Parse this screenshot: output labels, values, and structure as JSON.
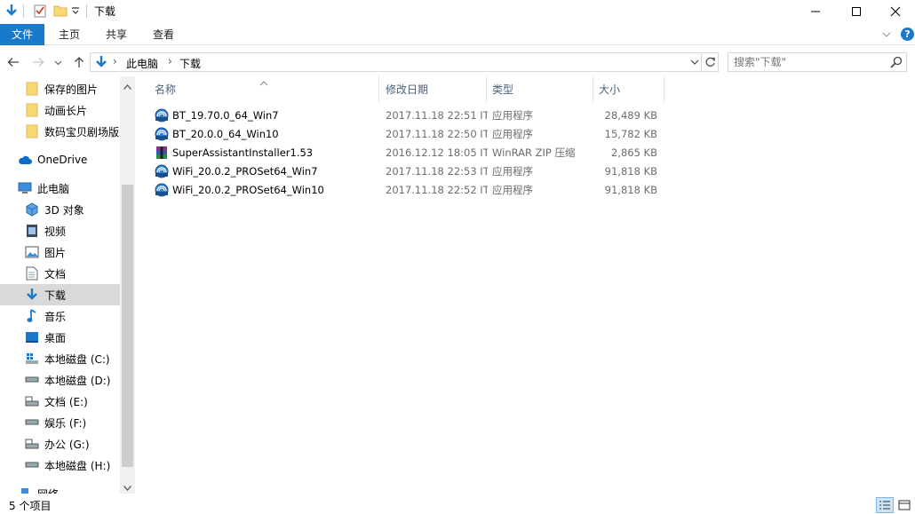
{
  "window": {
    "title": "下载"
  },
  "ribbon": {
    "tabs": [
      "文件",
      "主页",
      "共享",
      "查看"
    ]
  },
  "address": {
    "segments": [
      "此电脑",
      "下载"
    ],
    "sep": "›"
  },
  "search": {
    "placeholder": "搜索\"下载\""
  },
  "nav": {
    "items": [
      {
        "label": "保存的图片",
        "icon": "folder-icon"
      },
      {
        "label": "动画长片",
        "icon": "folder-icon"
      },
      {
        "label": "数码宝贝剧场版",
        "icon": "folder-icon"
      },
      {
        "label": "OneDrive",
        "icon": "cloud-icon"
      },
      {
        "label": "此电脑",
        "icon": "computer-icon"
      },
      {
        "label": "3D 对象",
        "icon": "cube-icon"
      },
      {
        "label": "视频",
        "icon": "video-icon"
      },
      {
        "label": "图片",
        "icon": "picture-icon"
      },
      {
        "label": "文档",
        "icon": "document-icon"
      },
      {
        "label": "下载",
        "icon": "download-icon"
      },
      {
        "label": "音乐",
        "icon": "music-icon"
      },
      {
        "label": "桌面",
        "icon": "desktop-icon"
      },
      {
        "label": "本地磁盘 (C:)",
        "icon": "system-drive-icon"
      },
      {
        "label": "本地磁盘 (D:)",
        "icon": "drive-icon"
      },
      {
        "label": "文档 (E:)",
        "icon": "drive-icon"
      },
      {
        "label": "娱乐 (F:)",
        "icon": "drive-icon"
      },
      {
        "label": "办公 (G:)",
        "icon": "drive-icon"
      },
      {
        "label": "本地磁盘 (H:)",
        "icon": "drive-icon"
      },
      {
        "label": "网络",
        "icon": "network-icon"
      }
    ]
  },
  "columns": {
    "name": "名称",
    "date": "修改日期",
    "type": "类型",
    "size": "大小"
  },
  "files": [
    {
      "name": "BT_19.70.0_64_Win7",
      "date": "2017.11.18 22:51 IT",
      "type": "应用程序",
      "size": "28,489 KB",
      "icon": "installer-icon"
    },
    {
      "name": "BT_20.0.0_64_Win10",
      "date": "2017.11.18 22:50 IT",
      "type": "应用程序",
      "size": "15,782 KB",
      "icon": "installer-icon"
    },
    {
      "name": "SuperAssistantInstaller1.53",
      "date": "2016.12.12 18:05 IT",
      "type": "WinRAR ZIP 压缩",
      "size": "2,865 KB",
      "icon": "winrar-icon"
    },
    {
      "name": "WiFi_20.0.2_PROSet64_Win7",
      "date": "2017.11.18 22:53 IT",
      "type": "应用程序",
      "size": "91,818 KB",
      "icon": "installer-icon"
    },
    {
      "name": "WiFi_20.0.2_PROSet64_Win10",
      "date": "2017.11.18 22:52 IT",
      "type": "应用程序",
      "size": "91,818 KB",
      "icon": "installer-icon"
    }
  ],
  "status": {
    "count": "5 个项目"
  },
  "colors": {
    "accent": "#1979ca",
    "selection": "#d9d9d9"
  }
}
